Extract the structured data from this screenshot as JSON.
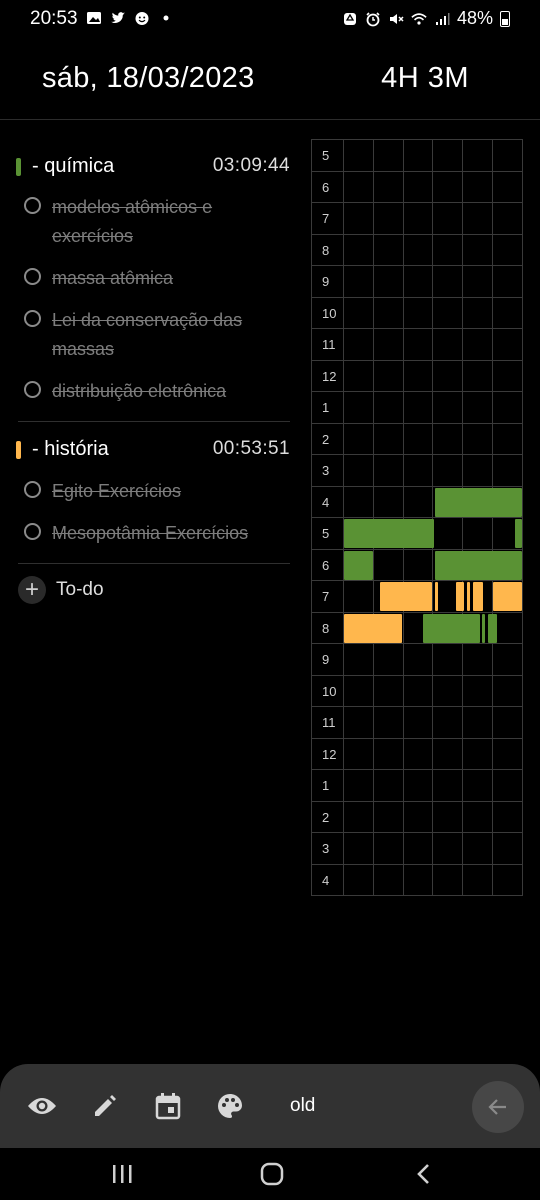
{
  "status_bar": {
    "time": "20:53",
    "left_icons": [
      "image-icon",
      "twitter-icon",
      "emoji-icon",
      "dot-icon"
    ],
    "right_icons": [
      "recycle-icon",
      "alarm-icon",
      "mute-icon",
      "wifi-icon",
      "signal-icon"
    ],
    "battery": "48%"
  },
  "header": {
    "date": "sáb, 18/03/2023",
    "total": "4H 3M"
  },
  "subjects": [
    {
      "name": "- química",
      "time": "03:09:44",
      "color": "#5a9234",
      "tasks": [
        "modelos atômicos e exercícios",
        "massa atômica",
        "Lei da conservação das massas",
        "distribuição eletrônica"
      ]
    },
    {
      "name": "- história",
      "time": "00:53:51",
      "color": "#ffb74d",
      "tasks": [
        "Egito Exercícios",
        "Mesopotâmia Exercícios"
      ]
    }
  ],
  "add_todo": "To-do",
  "hour_labels": [
    "5",
    "6",
    "7",
    "8",
    "9",
    "10",
    "11",
    "12",
    "1",
    "2",
    "3",
    "4",
    "5",
    "6",
    "7",
    "8",
    "9",
    "10",
    "11",
    "12",
    "1",
    "2",
    "3",
    "4"
  ],
  "timeline_activity": [
    {
      "hour_row": 11,
      "subject": "- química",
      "filled_fraction_of_hour": 0.5
    },
    {
      "hour_row": 12,
      "subject": "- química",
      "filled_fraction_of_hour": 0.6
    },
    {
      "hour_row": 13,
      "subject": "- química",
      "filled_fraction_of_hour": 0.6
    },
    {
      "hour_row": 14,
      "subject": "- história",
      "filled_fraction_of_hour": 0.65
    },
    {
      "hour_row": 15,
      "subject": "- história",
      "filled_fraction_of_hour": 0.35
    },
    {
      "hour_row": 15,
      "subject": "- química",
      "filled_fraction_of_hour": 0.45
    }
  ],
  "toolbar": {
    "icons": [
      "eye-icon",
      "pencil-icon",
      "calendar-icon",
      "palette-icon"
    ],
    "label": "old",
    "back_icon": "arrow-left-icon"
  },
  "navbar": {
    "icons": [
      "recent-apps-icon",
      "home-icon",
      "back-icon"
    ]
  }
}
